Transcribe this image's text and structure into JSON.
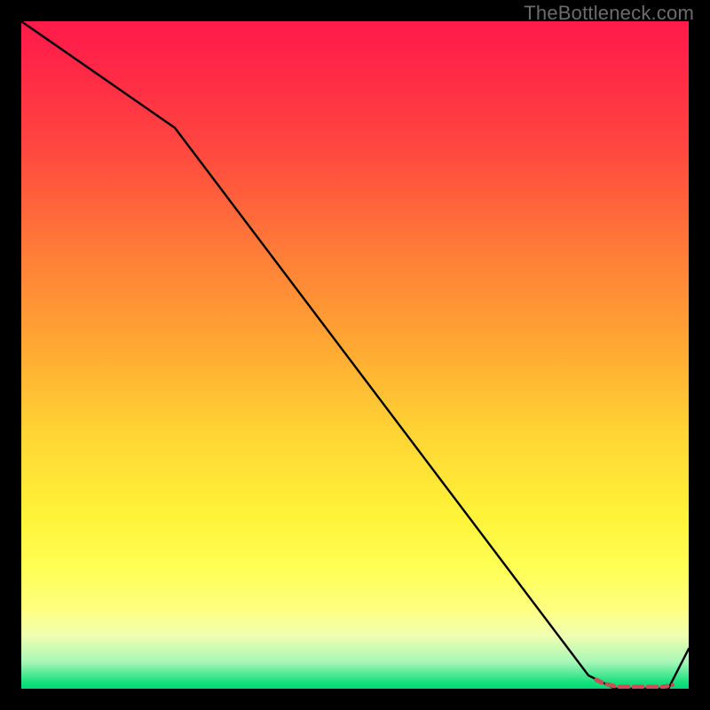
{
  "watermark": "TheBottleneck.com",
  "chart_data": {
    "type": "line",
    "x": [
      0.0,
      0.23,
      0.85,
      0.89,
      0.93,
      0.95,
      0.97,
      1.0
    ],
    "y": [
      1.0,
      0.84,
      0.02,
      0.0,
      0.0,
      0.0,
      0.0,
      0.06
    ],
    "xlim": [
      0,
      1
    ],
    "ylim": [
      0,
      1
    ],
    "title": "",
    "xlabel": "",
    "ylabel": "",
    "background": "heatmap-vertical-gradient",
    "markers": {
      "present": true,
      "color": "#c94f55",
      "style": "dashed-pill",
      "x_range": [
        0.87,
        0.97
      ]
    }
  }
}
